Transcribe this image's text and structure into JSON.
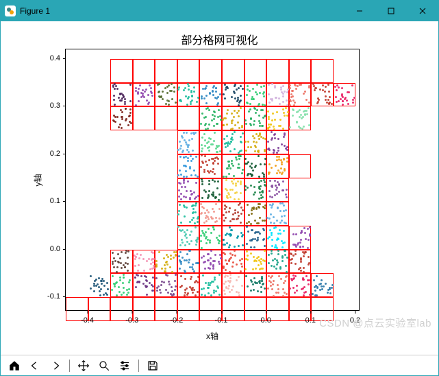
{
  "window": {
    "title": "Figure 1",
    "min_label": "Minimize",
    "max_label": "Maximize",
    "close_label": "Close"
  },
  "toolbar": {
    "home": "Home",
    "back": "Back",
    "forward": "Forward",
    "pan": "Pan",
    "zoom": "Zoom",
    "configure": "Configure subplots",
    "save": "Save figure"
  },
  "watermark": "CSDN @点云实验室lab",
  "chart_data": {
    "type": "scatter",
    "title": "部分格网可视化",
    "xlabel": "x轴",
    "ylabel": "y轴",
    "xlim": [
      -0.45,
      0.21
    ],
    "ylim": [
      -0.13,
      0.42
    ],
    "xticks": [
      -0.4,
      -0.3,
      -0.2,
      -0.1,
      0.0,
      0.1,
      0.2
    ],
    "yticks": [
      -0.1,
      0.0,
      0.1,
      0.2,
      0.3,
      0.4
    ],
    "grid_cell_size": 0.05,
    "grid_cells": [
      [
        -0.35,
        0.35
      ],
      [
        -0.3,
        0.35
      ],
      [
        -0.25,
        0.35
      ],
      [
        -0.2,
        0.35
      ],
      [
        -0.15,
        0.35
      ],
      [
        -0.1,
        0.35
      ],
      [
        -0.05,
        0.35
      ],
      [
        0.0,
        0.35
      ],
      [
        0.05,
        0.35
      ],
      [
        0.1,
        0.35
      ],
      [
        -0.35,
        0.3
      ],
      [
        -0.3,
        0.3
      ],
      [
        -0.25,
        0.3
      ],
      [
        -0.2,
        0.3
      ],
      [
        -0.15,
        0.3
      ],
      [
        -0.1,
        0.3
      ],
      [
        -0.05,
        0.3
      ],
      [
        0.0,
        0.3
      ],
      [
        0.05,
        0.3
      ],
      [
        0.1,
        0.3
      ],
      [
        0.15,
        0.3
      ],
      [
        -0.35,
        0.25
      ],
      [
        -0.3,
        0.25
      ],
      [
        -0.25,
        0.25
      ],
      [
        -0.2,
        0.25
      ],
      [
        -0.15,
        0.25
      ],
      [
        -0.1,
        0.25
      ],
      [
        -0.05,
        0.25
      ],
      [
        0.0,
        0.25
      ],
      [
        0.05,
        0.25
      ],
      [
        -0.2,
        0.2
      ],
      [
        -0.15,
        0.2
      ],
      [
        -0.1,
        0.2
      ],
      [
        -0.05,
        0.2
      ],
      [
        0.0,
        0.2
      ],
      [
        -0.2,
        0.15
      ],
      [
        -0.15,
        0.15
      ],
      [
        -0.1,
        0.15
      ],
      [
        -0.05,
        0.15
      ],
      [
        0.0,
        0.15
      ],
      [
        0.05,
        0.15
      ],
      [
        -0.2,
        0.1
      ],
      [
        -0.15,
        0.1
      ],
      [
        -0.1,
        0.1
      ],
      [
        -0.05,
        0.1
      ],
      [
        0.0,
        0.1
      ],
      [
        -0.2,
        0.05
      ],
      [
        -0.15,
        0.05
      ],
      [
        -0.1,
        0.05
      ],
      [
        -0.05,
        0.05
      ],
      [
        0.0,
        0.05
      ],
      [
        -0.2,
        0.0
      ],
      [
        -0.15,
        0.0
      ],
      [
        -0.1,
        0.0
      ],
      [
        -0.05,
        0.0
      ],
      [
        0.0,
        0.0
      ],
      [
        0.05,
        0.0
      ],
      [
        -0.35,
        -0.05
      ],
      [
        -0.3,
        -0.05
      ],
      [
        -0.25,
        -0.05
      ],
      [
        -0.2,
        -0.05
      ],
      [
        -0.15,
        -0.05
      ],
      [
        -0.1,
        -0.05
      ],
      [
        -0.05,
        -0.05
      ],
      [
        0.0,
        -0.05
      ],
      [
        0.05,
        -0.05
      ],
      [
        -0.35,
        -0.1
      ],
      [
        -0.3,
        -0.1
      ],
      [
        -0.25,
        -0.1
      ],
      [
        -0.2,
        -0.1
      ],
      [
        -0.15,
        -0.1
      ],
      [
        -0.1,
        -0.1
      ],
      [
        -0.05,
        -0.1
      ],
      [
        0.0,
        -0.1
      ],
      [
        0.05,
        -0.1
      ],
      [
        0.1,
        -0.1
      ],
      [
        -0.45,
        -0.15
      ],
      [
        -0.4,
        -0.15
      ],
      [
        -0.35,
        -0.15
      ],
      [
        -0.3,
        -0.15
      ],
      [
        -0.25,
        -0.15
      ],
      [
        -0.2,
        -0.15
      ],
      [
        -0.15,
        -0.15
      ],
      [
        -0.1,
        -0.15
      ],
      [
        -0.05,
        -0.15
      ],
      [
        0.0,
        -0.15
      ],
      [
        0.05,
        -0.15
      ],
      [
        0.1,
        -0.15
      ]
    ],
    "point_clusters": [
      {
        "c": "#4a235a",
        "x0": -0.35,
        "y0": 0.3
      },
      {
        "c": "#8e44ad",
        "x0": -0.3,
        "y0": 0.3
      },
      {
        "c": "#556b2f",
        "x0": -0.25,
        "y0": 0.3
      },
      {
        "c": "#1abc9c",
        "x0": -0.2,
        "y0": 0.3
      },
      {
        "c": "#2e86c1",
        "x0": -0.15,
        "y0": 0.3
      },
      {
        "c": "#154360",
        "x0": -0.1,
        "y0": 0.3
      },
      {
        "c": "#2ecc71",
        "x0": -0.05,
        "y0": 0.3
      },
      {
        "c": "#d2b4de",
        "x0": 0.0,
        "y0": 0.3
      },
      {
        "c": "#ec7063",
        "x0": 0.05,
        "y0": 0.3
      },
      {
        "c": "#c0392b",
        "x0": 0.1,
        "y0": 0.3
      },
      {
        "c": "#e91e63",
        "x0": 0.15,
        "y0": 0.3
      },
      {
        "c": "#7b241c",
        "x0": -0.35,
        "y0": 0.25
      },
      {
        "c": "#28b463",
        "x0": -0.15,
        "y0": 0.25
      },
      {
        "c": "#d4ac0d",
        "x0": -0.1,
        "y0": 0.25
      },
      {
        "c": "#27ae60",
        "x0": -0.05,
        "y0": 0.25
      },
      {
        "c": "#f1c40f",
        "x0": 0.0,
        "y0": 0.25
      },
      {
        "c": "#82e0aa",
        "x0": 0.05,
        "y0": 0.25
      },
      {
        "c": "#5dade2",
        "x0": -0.2,
        "y0": 0.2
      },
      {
        "c": "#58d68d",
        "x0": -0.15,
        "y0": 0.2
      },
      {
        "c": "#1abc9c",
        "x0": -0.1,
        "y0": 0.2
      },
      {
        "c": "#d4ac0d",
        "x0": -0.05,
        "y0": 0.2
      },
      {
        "c": "#7d3c98",
        "x0": 0.0,
        "y0": 0.2
      },
      {
        "c": "#3498db",
        "x0": -0.2,
        "y0": 0.15
      },
      {
        "c": "#c0392b",
        "x0": -0.15,
        "y0": 0.15
      },
      {
        "c": "#27ae60",
        "x0": -0.1,
        "y0": 0.15
      },
      {
        "c": "#145a32",
        "x0": -0.05,
        "y0": 0.15
      },
      {
        "c": "#f39c12",
        "x0": 0.0,
        "y0": 0.15
      },
      {
        "c": "#8e44ad",
        "x0": -0.2,
        "y0": 0.1
      },
      {
        "c": "#145a32",
        "x0": -0.15,
        "y0": 0.1
      },
      {
        "c": "#f4d03f",
        "x0": -0.1,
        "y0": 0.1
      },
      {
        "c": "#1e8449",
        "x0": -0.05,
        "y0": 0.1
      },
      {
        "c": "#884ea0",
        "x0": 0.0,
        "y0": 0.1
      },
      {
        "c": "#1abc9c",
        "x0": -0.2,
        "y0": 0.05
      },
      {
        "c": "#f1948a",
        "x0": -0.15,
        "y0": 0.05
      },
      {
        "c": "#b03a2e",
        "x0": -0.1,
        "y0": 0.05
      },
      {
        "c": "#7d6608",
        "x0": -0.05,
        "y0": 0.05
      },
      {
        "c": "#5dade2",
        "x0": 0.0,
        "y0": 0.05
      },
      {
        "c": "#48c9b0",
        "x0": -0.2,
        "y0": 0.0
      },
      {
        "c": "#2ecc71",
        "x0": -0.15,
        "y0": 0.0
      },
      {
        "c": "#0097a7",
        "x0": -0.1,
        "y0": 0.0
      },
      {
        "c": "#21618c",
        "x0": -0.05,
        "y0": 0.0
      },
      {
        "c": "#00e5ff",
        "x0": 0.0,
        "y0": 0.0
      },
      {
        "c": "#8e44ad",
        "x0": 0.05,
        "y0": 0.0
      },
      {
        "c": "#5d4037",
        "x0": -0.35,
        "y0": -0.05
      },
      {
        "c": "#f48fb1",
        "x0": -0.3,
        "y0": -0.05
      },
      {
        "c": "#d4ac0d",
        "x0": -0.25,
        "y0": -0.05
      },
      {
        "c": "#2e86c1",
        "x0": -0.2,
        "y0": -0.05
      },
      {
        "c": "#8e44ad",
        "x0": -0.15,
        "y0": -0.05
      },
      {
        "c": "#e74c3c",
        "x0": -0.1,
        "y0": -0.05
      },
      {
        "c": "#f1c40f",
        "x0": -0.05,
        "y0": -0.05
      },
      {
        "c": "#16a085",
        "x0": 0.0,
        "y0": -0.05
      },
      {
        "c": "#c0392b",
        "x0": 0.05,
        "y0": -0.05
      },
      {
        "c": "#1a5276",
        "x0": -0.4,
        "y0": -0.1
      },
      {
        "c": "#2ecc71",
        "x0": -0.35,
        "y0": -0.1
      },
      {
        "c": "#6c3483",
        "x0": -0.3,
        "y0": -0.1
      },
      {
        "c": "#76448a",
        "x0": -0.25,
        "y0": -0.1
      },
      {
        "c": "#c0392b",
        "x0": -0.2,
        "y0": -0.1
      },
      {
        "c": "#1abc9c",
        "x0": -0.15,
        "y0": -0.1
      },
      {
        "c": "#f5b7b1",
        "x0": -0.1,
        "y0": -0.1
      },
      {
        "c": "#117864",
        "x0": -0.05,
        "y0": -0.1
      },
      {
        "c": "#ec7063",
        "x0": 0.0,
        "y0": -0.1
      },
      {
        "c": "#e91e63",
        "x0": 0.05,
        "y0": -0.1
      },
      {
        "c": "#2874a6",
        "x0": 0.1,
        "y0": -0.1
      }
    ],
    "points_per_cluster": 25
  }
}
